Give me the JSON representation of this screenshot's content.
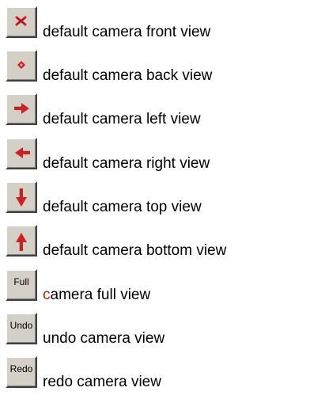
{
  "colors": {
    "icon_red": "#d21f1f",
    "accent_text": "#b32400",
    "button_face": "#d4d0c8"
  },
  "items": [
    {
      "icon": "x-mark-icon",
      "label": "default camera front view"
    },
    {
      "icon": "dot-icon",
      "label": "default camera back view"
    },
    {
      "icon": "arrow-right-icon",
      "label": "default camera left view"
    },
    {
      "icon": "arrow-left-icon",
      "label": "default camera right view"
    },
    {
      "icon": "arrow-down-icon",
      "label": "default camera top view"
    },
    {
      "icon": "arrow-up-icon",
      "label": "default camera bottom view"
    },
    {
      "button_text": "Full",
      "label_first": "c",
      "label_rest": "amera full view"
    },
    {
      "button_text": "Undo",
      "label": "undo camera view"
    },
    {
      "button_text": "Redo",
      "label": "redo camera view"
    }
  ]
}
